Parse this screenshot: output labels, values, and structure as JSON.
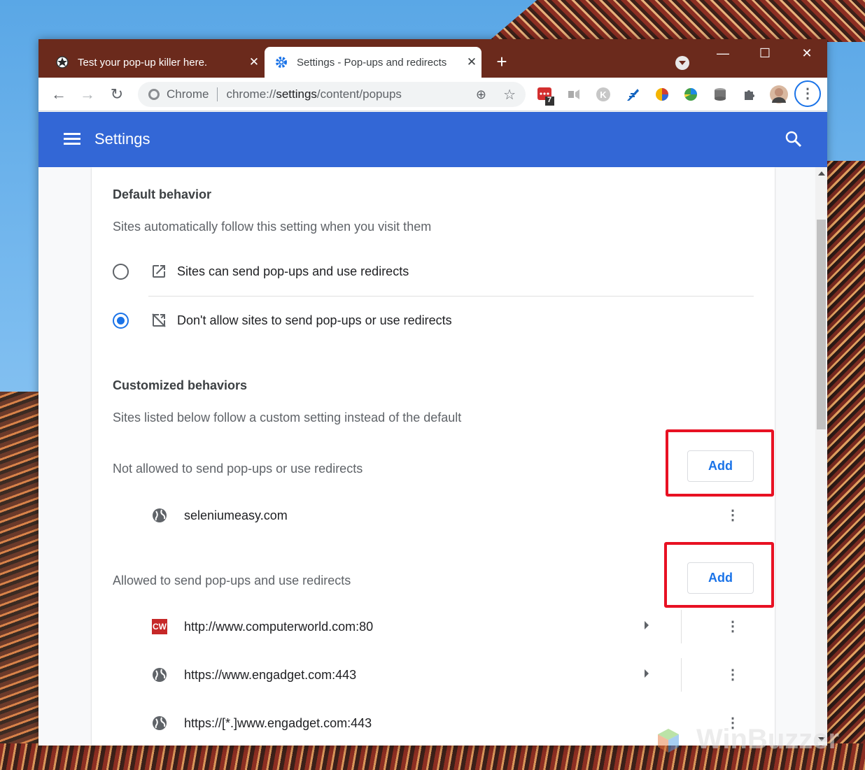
{
  "tabs": [
    {
      "title": "Test your pop-up killer here.",
      "active": false
    },
    {
      "title": "Settings - Pop-ups and redirects",
      "active": true
    }
  ],
  "address_bar": {
    "chip": "Chrome",
    "url_scheme": "chrome://",
    "url_host": "settings",
    "url_path": "/content/popups"
  },
  "extension_badge": "7",
  "header": {
    "title": "Settings"
  },
  "default_behavior": {
    "title": "Default behavior",
    "subtitle": "Sites automatically follow this setting when you visit them",
    "options": [
      {
        "label": "Sites can send pop-ups and use redirects",
        "checked": false
      },
      {
        "label": "Don't allow sites to send pop-ups or use redirects",
        "checked": true
      }
    ]
  },
  "customized": {
    "title": "Customized behaviors",
    "subtitle": "Sites listed below follow a custom setting instead of the default",
    "blocked": {
      "label": "Not allowed to send pop-ups or use redirects",
      "add_label": "Add",
      "sites": [
        "seleniumeasy.com"
      ]
    },
    "allowed": {
      "label": "Allowed to send pop-ups and use redirects",
      "add_label": "Add",
      "sites": [
        {
          "url": "http://www.computerworld.com:80",
          "icon": "cw-favicon",
          "cw_text": "CW"
        },
        {
          "url": "https://www.engadget.com:443",
          "icon": "globe-icon"
        },
        {
          "url": "https://[*.]www.engadget.com:443",
          "icon": "globe-icon"
        }
      ]
    }
  },
  "colors": {
    "accent": "#1a73e8",
    "header": "#3367d6",
    "highlight": "#e81123",
    "tabstrip": "#6b2a1c"
  },
  "watermark": "WinBuzzer"
}
